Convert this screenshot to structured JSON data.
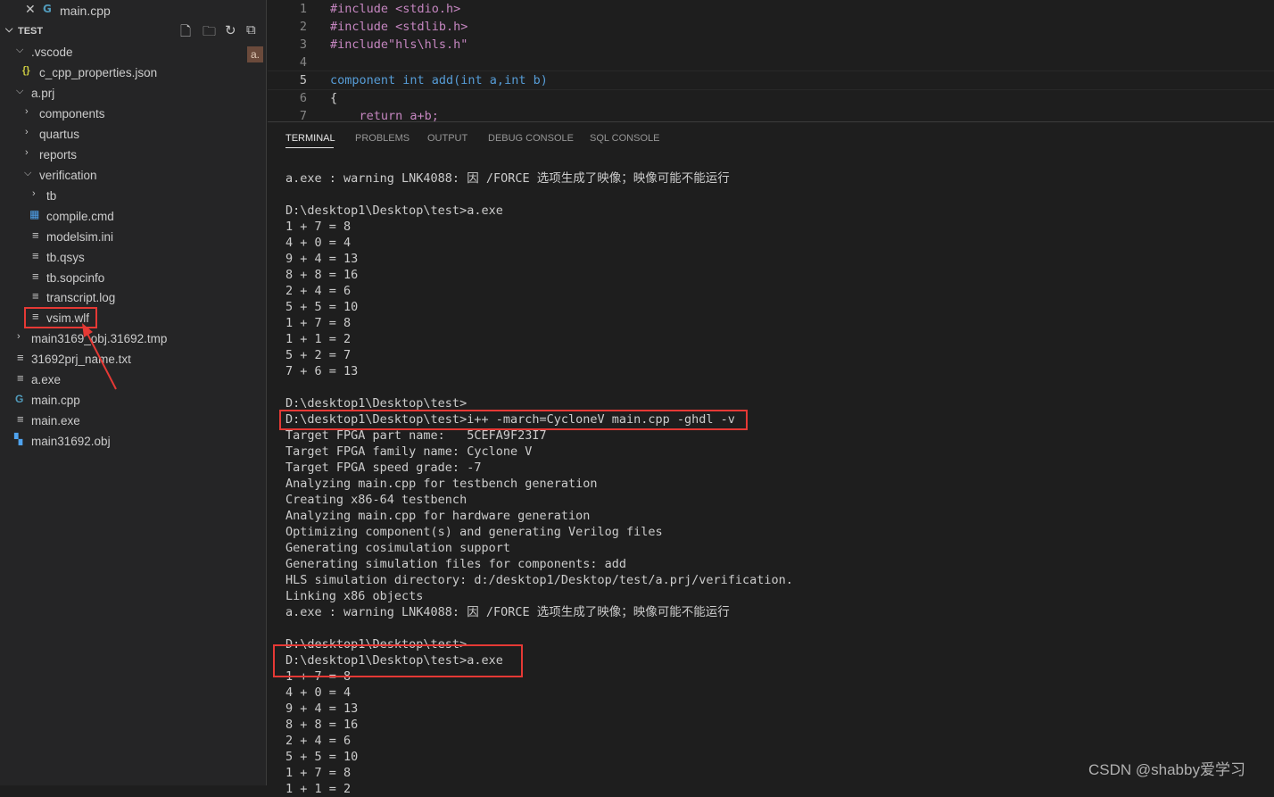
{
  "open_editor": {
    "close_glyph": "✕",
    "file_icon": "C++ file icon",
    "file_name": "main.cpp"
  },
  "explorer": {
    "section_title": "TEST",
    "actions": [
      "new-file-icon",
      "new-folder-icon",
      "refresh-icon",
      "collapse-all-icon"
    ],
    "badge": "a.",
    "items": [
      {
        "label": ".vscode",
        "type": "folder-open"
      },
      {
        "label": "c_cpp_properties.json",
        "type": "json"
      },
      {
        "label": "a.prj",
        "type": "folder-open"
      },
      {
        "label": "components",
        "type": "folder-closed"
      },
      {
        "label": "quartus",
        "type": "folder-closed"
      },
      {
        "label": "reports",
        "type": "folder-closed"
      },
      {
        "label": "verification",
        "type": "folder-open"
      },
      {
        "label": "tb",
        "type": "folder-closed"
      },
      {
        "label": "compile.cmd",
        "type": "windows"
      },
      {
        "label": "modelsim.ini",
        "type": "text"
      },
      {
        "label": "tb.qsys",
        "type": "text"
      },
      {
        "label": "tb.sopcinfo",
        "type": "text"
      },
      {
        "label": "transcript.log",
        "type": "text"
      },
      {
        "label": "vsim.wlf",
        "type": "text"
      },
      {
        "label": "main3169_obj.31692.tmp",
        "type": "folder-closed"
      },
      {
        "label": "31692prj_name.txt",
        "type": "text"
      },
      {
        "label": "a.exe",
        "type": "text"
      },
      {
        "label": "main.cpp",
        "type": "cpp"
      },
      {
        "label": "main.exe",
        "type": "text"
      },
      {
        "label": "main31692.obj",
        "type": "obj"
      }
    ]
  },
  "editor": {
    "lines": [
      {
        "n": "1",
        "text": "#include <stdio.h>"
      },
      {
        "n": "2",
        "text": "#include <stdlib.h>"
      },
      {
        "n": "3",
        "text": "#include\"hls\\hls.h\""
      },
      {
        "n": "4",
        "text": ""
      },
      {
        "n": "5",
        "text": "component int add(int a,int b)"
      },
      {
        "n": "6",
        "text": "{"
      },
      {
        "n": "7",
        "text": "    return a+b;"
      }
    ]
  },
  "panel": {
    "tabs": [
      "TERMINAL",
      "PROBLEMS",
      "OUTPUT",
      "DEBUG CONSOLE",
      "SQL CONSOLE"
    ],
    "terminal_lines": [
      "a.exe : warning LNK4088: 因 /FORCE 选项生成了映像；映像可能不能运行",
      "",
      "D:\\desktop1\\Desktop\\test>a.exe",
      "1 + 7 = 8",
      "4 + 0 = 4",
      "9 + 4 = 13",
      "8 + 8 = 16",
      "2 + 4 = 6",
      "5 + 5 = 10",
      "1 + 7 = 8",
      "1 + 1 = 2",
      "5 + 2 = 7",
      "7 + 6 = 13",
      "",
      "D:\\desktop1\\Desktop\\test>",
      "D:\\desktop1\\Desktop\\test>i++ -march=CycloneV main.cpp -ghdl -v",
      "Target FPGA part name:   5CEFA9F23I7",
      "Target FPGA family name: Cyclone V",
      "Target FPGA speed grade: -7",
      "Analyzing main.cpp for testbench generation",
      "Creating x86-64 testbench",
      "Analyzing main.cpp for hardware generation",
      "Optimizing component(s) and generating Verilog files",
      "Generating cosimulation support",
      "Generating simulation files for components: add",
      "HLS simulation directory: d:/desktop1/Desktop/test/a.prj/verification.",
      "Linking x86 objects",
      "a.exe : warning LNK4088: 因 /FORCE 选项生成了映像；映像可能不能运行",
      "",
      "D:\\desktop1\\Desktop\\test>",
      "D:\\desktop1\\Desktop\\test>a.exe",
      "1 + 7 = 8",
      "4 + 0 = 4",
      "9 + 4 = 13",
      "8 + 8 = 16",
      "2 + 4 = 6",
      "5 + 5 = 10",
      "1 + 7 = 8",
      "1 + 1 = 2"
    ]
  },
  "watermark": "CSDN @shabby爱学习",
  "colors": {
    "highlight": "#e53935",
    "sidebar_bg": "#252526",
    "editor_bg": "#1e1e1e"
  }
}
